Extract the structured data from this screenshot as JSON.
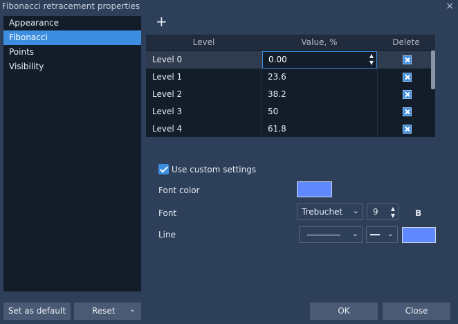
{
  "window": {
    "title": "Fibonacci retracement properties",
    "close_glyph": "×"
  },
  "sidebar": {
    "items": [
      {
        "label": "Appearance"
      },
      {
        "label": "Fibonacci",
        "active": true
      },
      {
        "label": "Points"
      },
      {
        "label": "Visibility"
      }
    ]
  },
  "toolbar": {
    "add_glyph": "+"
  },
  "levels_table": {
    "columns": [
      "Level",
      "Value, %",
      "Delete"
    ],
    "rows": [
      {
        "level": "Level 0",
        "value": "0.00"
      },
      {
        "level": "Level 1",
        "value": "23.6"
      },
      {
        "level": "Level 2",
        "value": "38.2"
      },
      {
        "level": "Level 3",
        "value": "50"
      },
      {
        "level": "Level 4",
        "value": "61.8"
      }
    ]
  },
  "settings": {
    "use_custom_label": "Use custom settings",
    "use_custom_checked": true,
    "font_color_label": "Font color",
    "font_color": "#6089ff",
    "font_label": "Font",
    "font_value": "Trebuchet",
    "font_size": "9",
    "bold_label": "B",
    "line_label": "Line",
    "line_color": "#6089ff"
  },
  "footer": {
    "set_default_label": "Set as default",
    "reset_label": "Reset",
    "ok_label": "OK",
    "close_label": "Close"
  },
  "colors": {
    "accent": "#3d8ee0",
    "panel": "#131c29",
    "background": "#2e3f5a"
  }
}
